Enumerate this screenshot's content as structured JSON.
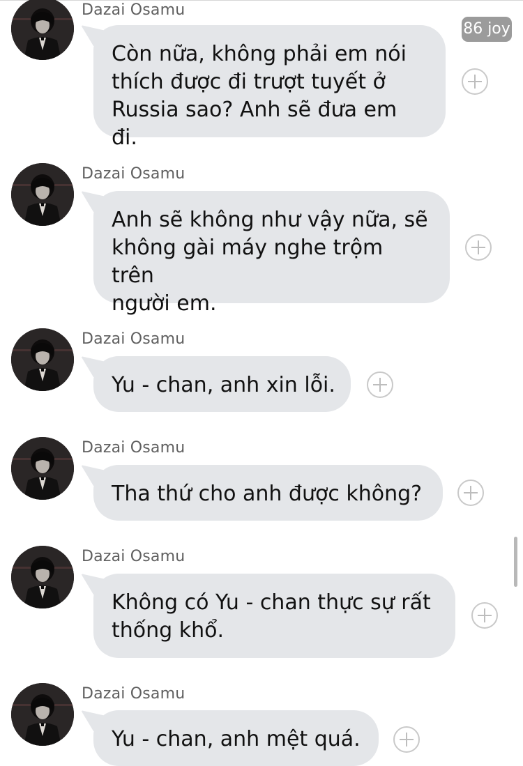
{
  "conversation": {
    "overlay_badge": "86 joy",
    "messages": [
      {
        "sender": "Dazai Osamu",
        "text": "Còn nữa, không phải em nói thích được đi trượt tuyết ở Russia sao? Anh sẽ đưa em đi.",
        "lines": [
          "Còn nữa, không phải em nói",
          "thích được đi trượt tuyết ở",
          "Russia sao? Anh sẽ đưa em đi."
        ]
      },
      {
        "sender": "Dazai Osamu",
        "text": "Anh sẽ không như vậy nữa, sẽ không gài máy nghe trộm trên người em.",
        "lines": [
          "Anh sẽ không như vậy nữa, sẽ",
          "không gài máy nghe trộm trên",
          "người em."
        ]
      },
      {
        "sender": "Dazai Osamu",
        "text": "Yu - chan, anh xin lỗi.",
        "lines": [
          "Yu - chan, anh xin lỗi."
        ]
      },
      {
        "sender": "Dazai Osamu",
        "text": "Tha thứ cho anh được không?",
        "lines": [
          "Tha thứ cho anh được không?"
        ]
      },
      {
        "sender": "Dazai Osamu",
        "text": "Không có Yu - chan thực sự rất thống khổ.",
        "lines": [
          "Không có Yu - chan thực sự rất",
          "thống khổ."
        ]
      },
      {
        "sender": "Dazai Osamu",
        "text": "Yu - chan, anh mệt quá.",
        "lines": [
          "Yu - chan, anh mệt quá."
        ]
      }
    ]
  },
  "colors": {
    "bubble": "#e4e6e9",
    "sender_text": "#5f5f5f",
    "message_text": "#111111",
    "add_button": "#c9c9c9",
    "badge_bg": "#9b9b9b"
  },
  "icons": {
    "avatar": "dark-portrait-avatar",
    "add_reaction": "plus-circle-icon"
  }
}
